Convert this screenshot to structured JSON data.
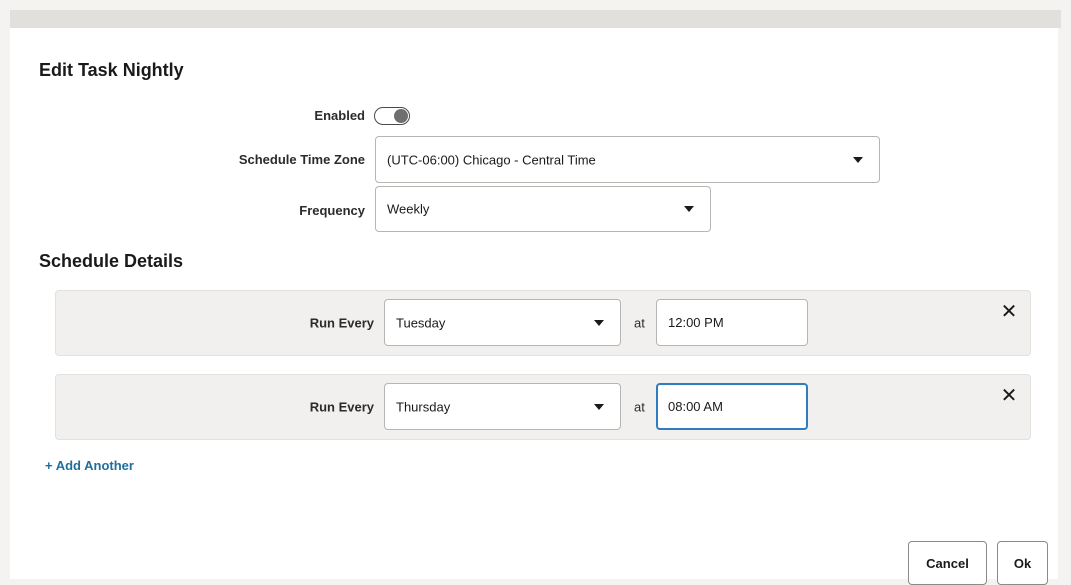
{
  "dialog": {
    "title": "Edit Task Nightly"
  },
  "form": {
    "enabled_label": "Enabled",
    "enabled_value": false,
    "timezone_label": "Schedule Time Zone",
    "timezone_value": "(UTC-06:00) Chicago - Central Time",
    "frequency_label": "Frequency",
    "frequency_value": "Weekly"
  },
  "schedule": {
    "section_title": "Schedule Details",
    "rows": [
      {
        "run_label": "Run Every",
        "day": "Tuesday",
        "at_label": "at",
        "time": "12:00 PM"
      },
      {
        "run_label": "Run Every",
        "day": "Thursday",
        "at_label": "at",
        "time": "08:00 AM"
      }
    ],
    "remove_glyph": "✕",
    "add_label": "+ Add Another"
  },
  "footer": {
    "cancel_label": "Cancel",
    "ok_label": "Ok"
  },
  "colors": {
    "accent": "#2f7cbf",
    "link": "#1f6f9b"
  }
}
